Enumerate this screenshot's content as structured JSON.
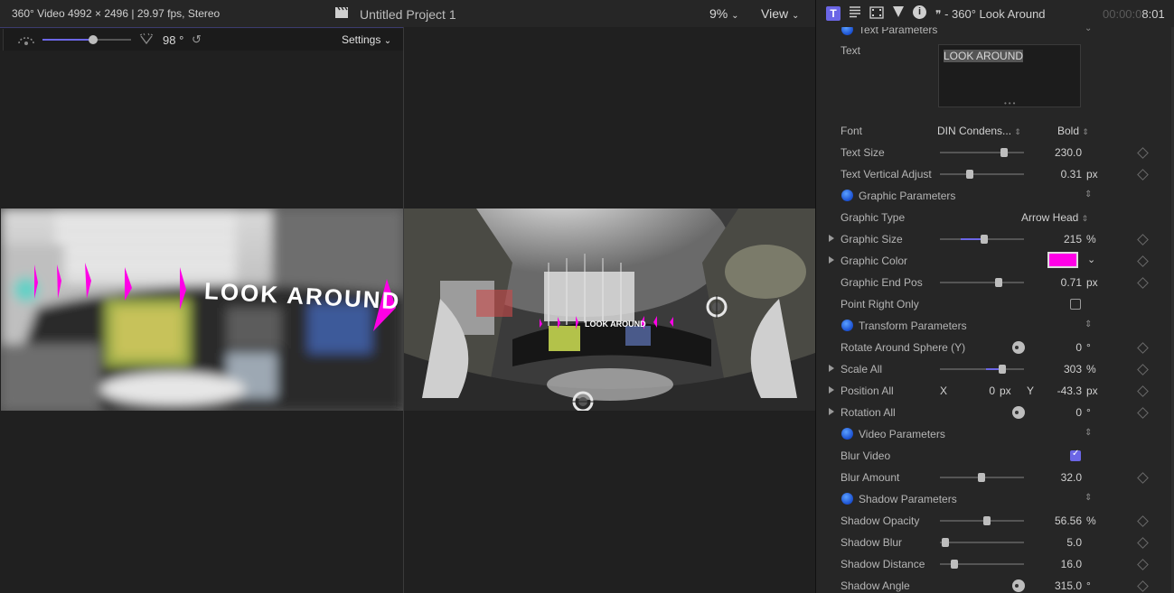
{
  "viewer": {
    "clip_info": "360° Video 4992 × 2496 | 29.97 fps, Stereo",
    "project_title": "Untitled Project 1",
    "zoom": "9%",
    "view_menu": "View",
    "field_of_view": "98 °",
    "settings_label": "Settings",
    "overlay_text": "LOOK AROUND",
    "fov_fraction": 0.6
  },
  "inspector": {
    "title": "360° Look Around",
    "timecode_dim": "00:00:0",
    "timecode": "8:01",
    "text_parameters_label": "Text Parameters",
    "text_label": "Text",
    "text_value": "LOOK AROUND",
    "font_label": "Font",
    "font_family": "DIN Condens...",
    "font_weight": "Bold",
    "text_size_label": "Text Size",
    "text_size": "230.0",
    "text_vertical_adjust_label": "Text Vertical Adjust",
    "text_vertical_adjust": "0.31",
    "graphic_parameters_label": "Graphic Parameters",
    "graphic_type_label": "Graphic Type",
    "graphic_type": "Arrow Head",
    "graphic_size_label": "Graphic Size",
    "graphic_size": "215",
    "graphic_color_label": "Graphic Color",
    "graphic_color_hex": "#ff00e6",
    "graphic_end_pos_label": "Graphic End Pos",
    "graphic_end_pos": "0.71",
    "point_right_only_label": "Point Right Only",
    "transform_parameters_label": "Transform Parameters",
    "rotate_around_sphere_label": "Rotate Around Sphere (Y)",
    "rotate_around_sphere": "0",
    "scale_all_label": "Scale All",
    "scale_all": "303",
    "position_all_label": "Position All",
    "position_x_label": "X",
    "position_x": "0",
    "position_y_label": "Y",
    "position_y": "-43.3",
    "rotation_all_label": "Rotation All",
    "rotation_all": "0",
    "video_parameters_label": "Video Parameters",
    "blur_video_label": "Blur Video",
    "blur_amount_label": "Blur Amount",
    "blur_amount": "32.0",
    "shadow_parameters_label": "Shadow Parameters",
    "shadow_opacity_label": "Shadow Opacity",
    "shadow_opacity": "56.56",
    "shadow_blur_label": "Shadow Blur",
    "shadow_blur": "5.0",
    "shadow_distance_label": "Shadow Distance",
    "shadow_distance": "16.0",
    "shadow_angle_label": "Shadow Angle",
    "shadow_angle": "315.0",
    "unit_px": "px",
    "unit_percent": "%",
    "unit_degree": "°"
  },
  "colors": {
    "accent": "#6b66e6",
    "magenta": "#ff00e6"
  }
}
